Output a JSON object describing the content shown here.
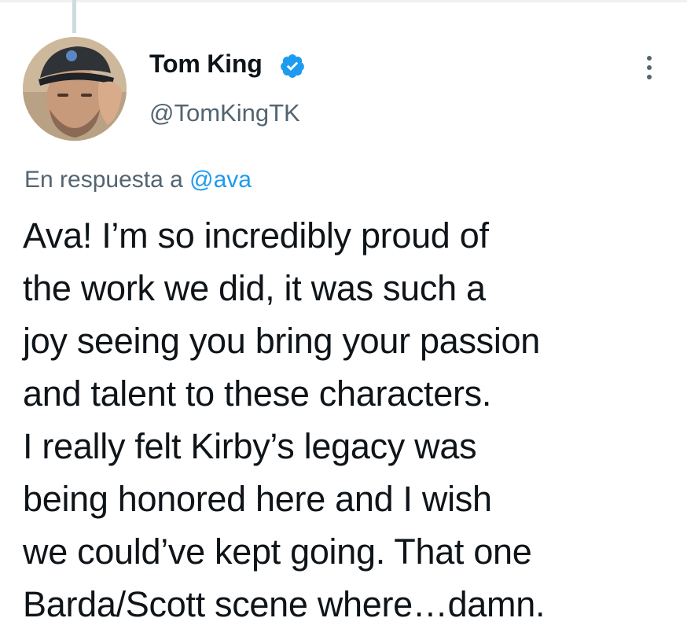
{
  "tweet": {
    "author": {
      "display_name": "Tom King",
      "handle": "@TomKingTK",
      "verified": true,
      "avatar_icon": "profile-photo-man-in-cap"
    },
    "reply_to": {
      "prefix": "En respuesta a",
      "handle": "@ava"
    },
    "text_lines": [
      "Ava! I’m so incredibly proud of",
      "the work we did, it was such a",
      "joy seeing you bring your passion",
      "and talent to these characters.",
      "I really felt Kirby’s legacy was",
      "being honored here and I wish",
      "we could’ve kept going. That one",
      "Barda/Scott scene where…damn."
    ],
    "more_icon": "vertical-ellipsis-icon"
  },
  "colors": {
    "text_primary": "#0f1419",
    "text_secondary": "#536471",
    "accent": "#1d9bf0",
    "thread_line": "#cfd9de"
  }
}
